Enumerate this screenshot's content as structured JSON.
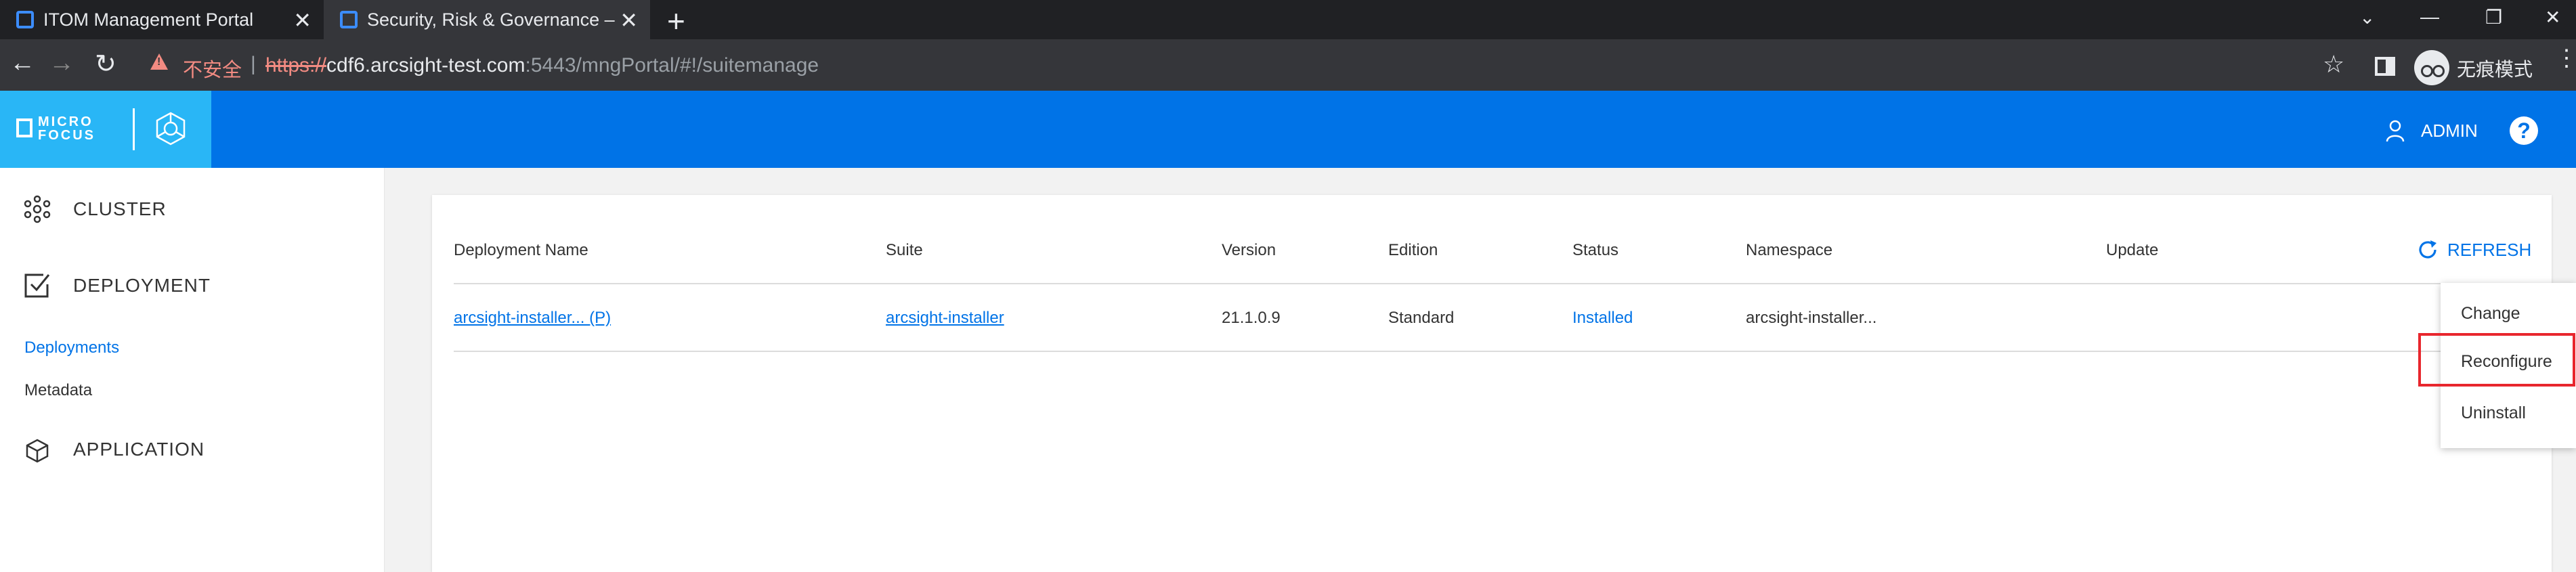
{
  "browser": {
    "tabs": [
      {
        "title": "ITOM Management Portal"
      },
      {
        "title": "Security, Risk & Governance –"
      }
    ],
    "tab_close": "✕",
    "new_tab": "+",
    "window_controls": {
      "minimize": "—",
      "restore": "❐",
      "close": "✕",
      "chevron": "⌄"
    },
    "security_label": "不安全",
    "url": {
      "scheme": "https://",
      "host": "cdf6.arcsight-test.com",
      "rest": ":5443/mngPortal/#!/suitemanage"
    },
    "incognito_label": "无痕模式",
    "icons": {
      "back": "←",
      "forward": "→",
      "reload": "↻",
      "star": "☆",
      "menu": "⋮"
    }
  },
  "app": {
    "logo_line1": "MICRO",
    "logo_line2": "FOCUS",
    "user": "ADMIN",
    "help": "?",
    "colors": {
      "header": "#0073e7",
      "logo_area": "#29b6f6",
      "link": "#0073e7",
      "highlight": "#e8262d"
    }
  },
  "sidebar": {
    "cluster": "CLUSTER",
    "deployment": "DEPLOYMENT",
    "deployments": "Deployments",
    "metadata": "Metadata",
    "application": "APPLICATION"
  },
  "table": {
    "headers": {
      "name": "Deployment Name",
      "suite": "Suite",
      "version": "Version",
      "edition": "Edition",
      "status": "Status",
      "namespace": "Namespace",
      "update": "Update"
    },
    "refresh": "REFRESH",
    "rows": [
      {
        "name": "arcsight-installer... (P)",
        "suite": "arcsight-installer",
        "version": "21.1.0.9",
        "edition": "Standard",
        "status": "Installed",
        "namespace": "arcsight-installer..."
      }
    ]
  },
  "context_menu": {
    "change": "Change",
    "reconfigure": "Reconfigure",
    "uninstall": "Uninstall"
  }
}
